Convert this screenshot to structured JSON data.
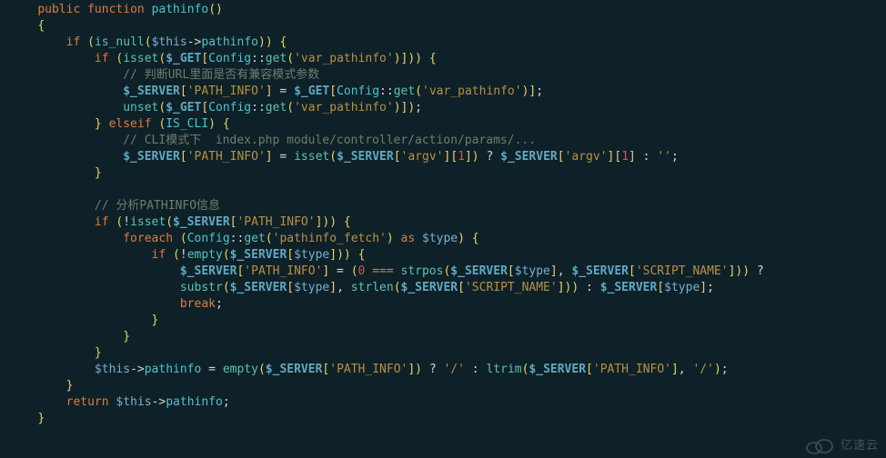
{
  "code": {
    "l00": "    ",
    "l01_public": "public",
    "l01_function": "function",
    "l01_name": "pathinfo",
    "l02_brace": "{",
    "l03_if": "if",
    "l03_isnull": "is_null",
    "l03_this": "$this",
    "l03_prop": "pathinfo",
    "l04_if": "if",
    "l04_isset": "isset",
    "l04_get": "$_GET",
    "l04_cfg": "Config",
    "l04_get2": "get",
    "l04_str": "'var_pathinfo'",
    "l05_cm": "// 判断URL里面是否有兼容模式参数",
    "l06_srv": "$_SERVER",
    "l06_pi": "'PATH_INFO'",
    "l06_get": "$_GET",
    "l06_cfg": "Config",
    "l06_get2": "get",
    "l06_str": "'var_pathinfo'",
    "l07_unset": "unset",
    "l07_get": "$_GET",
    "l07_cfg": "Config",
    "l07_get2": "get",
    "l07_str": "'var_pathinfo'",
    "l08_elseif": "elseif",
    "l08_iscli": "IS_CLI",
    "l09_cm": "// CLI模式下  index.php module/controller/action/params/...",
    "l10_srv": "$_SERVER",
    "l10_pi": "'PATH_INFO'",
    "l10_isset": "isset",
    "l10_srv2": "$_SERVER",
    "l10_argv": "'argv'",
    "l10_one": "1",
    "l10_srv3": "$_SERVER",
    "l10_argv2": "'argv'",
    "l10_one2": "1",
    "l10_empty": "''",
    "l12_cm": "// 分析PATHINFO信息",
    "l13_if": "if",
    "l13_isset": "isset",
    "l13_srv": "$_SERVER",
    "l13_pi": "'PATH_INFO'",
    "l14_foreach": "foreach",
    "l14_cfg": "Config",
    "l14_get": "get",
    "l14_str": "'pathinfo_fetch'",
    "l14_as": "as",
    "l14_type": "$type",
    "l15_if": "if",
    "l15_empty": "empty",
    "l15_srv": "$_SERVER",
    "l15_type": "$type",
    "l16_srv": "$_SERVER",
    "l16_pi": "'PATH_INFO'",
    "l16_zero": "0",
    "l16_eqeqeq": "===",
    "l16_strpos": "strpos",
    "l16_srv2": "$_SERVER",
    "l16_type": "$type",
    "l16_srv3": "$_SERVER",
    "l16_sn": "'SCRIPT_NAME'",
    "l17_substr": "substr",
    "l17_srv": "$_SERVER",
    "l17_type": "$type",
    "l17_strlen": "strlen",
    "l17_srv2": "$_SERVER",
    "l17_sn": "'SCRIPT_NAME'",
    "l17_srv3": "$_SERVER",
    "l17_type2": "$type",
    "l18_break": "break",
    "l22_this": "$this",
    "l22_prop": "pathinfo",
    "l22_empty": "empty",
    "l22_srv": "$_SERVER",
    "l22_pi": "'PATH_INFO'",
    "l22_slash": "'/'",
    "l22_ltrim": "ltrim",
    "l22_srv2": "$_SERVER",
    "l22_pi2": "'PATH_INFO'",
    "l22_slash2": "'/'",
    "l24_return": "return",
    "l24_this": "$this",
    "l24_prop": "pathinfo"
  },
  "watermark": "亿速云"
}
